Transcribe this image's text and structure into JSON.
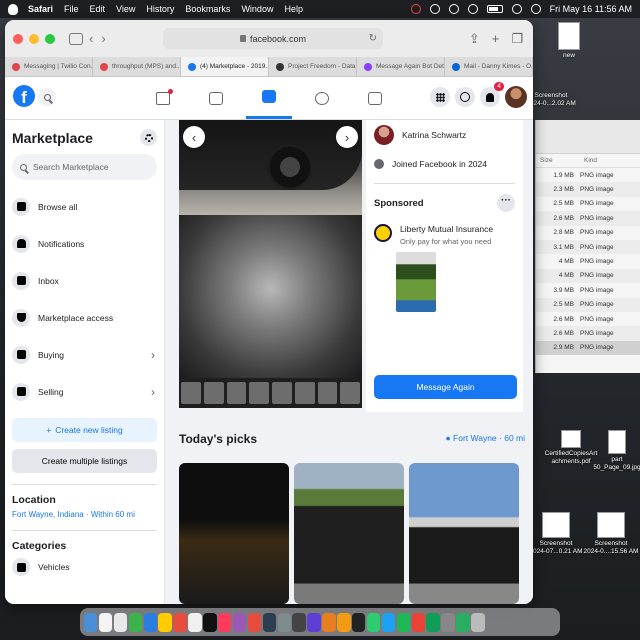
{
  "menubar": {
    "app": "Safari",
    "items": [
      "File",
      "Edit",
      "View",
      "History",
      "Bookmarks",
      "Window",
      "Help"
    ],
    "clock": "Fri May 16  11:56 AM"
  },
  "browser": {
    "url": "facebook.com",
    "tabs": [
      {
        "label": "Messaging | Twilio Con...",
        "color": "#e2434b"
      },
      {
        "label": "throughput (MPS) and...",
        "color": "#e2434b"
      },
      {
        "label": "(4) Marketplace - 2019...",
        "color": "#1877f2"
      },
      {
        "label": "Project Freedom - Data...",
        "color": "#333333"
      },
      {
        "label": "Message Again Bot Det...",
        "color": "#8a3ffc"
      },
      {
        "label": "Mail - Danny Kimes - O...",
        "color": "#0a64d6"
      }
    ]
  },
  "header": {
    "logo": "f",
    "notifications_badge": "4"
  },
  "sidebar": {
    "title": "Marketplace",
    "search_placeholder": "Search Marketplace",
    "items": [
      {
        "label": "Browse all"
      },
      {
        "label": "Notifications"
      },
      {
        "label": "Inbox"
      },
      {
        "label": "Marketplace access"
      },
      {
        "label": "Buying"
      },
      {
        "label": "Selling"
      }
    ],
    "create_listing": "Create new listing",
    "create_multiple": "Create multiple listings",
    "location_heading": "Location",
    "location_value": "Fort Wayne, Indiana · Within 60 mi",
    "categories_heading": "Categories",
    "first_category": "Vehicles"
  },
  "listing": {
    "seller_name": "Katrina Schwartz",
    "joined": "Joined Facebook in 2024",
    "sponsored_heading": "Sponsored",
    "ad_name": "Liberty Mutual Insurance",
    "ad_text": "Only pay for what you need",
    "message_button": "Message Again"
  },
  "picks": {
    "heading": "Today's picks",
    "location": "Fort Wayne · 60 mi"
  },
  "finder": {
    "columns": [
      "Size",
      "Kind"
    ],
    "rows": [
      {
        "size": "1.9 MB",
        "kind": "PNG image"
      },
      {
        "size": "2.3 MB",
        "kind": "PNG image"
      },
      {
        "size": "2.5 MB",
        "kind": "PNG image"
      },
      {
        "size": "2.6 MB",
        "kind": "PNG image"
      },
      {
        "size": "2.8 MB",
        "kind": "PNG image"
      },
      {
        "size": "3.1 MB",
        "kind": "PNG image"
      },
      {
        "size": "4 MB",
        "kind": "PNG image"
      },
      {
        "size": "4 MB",
        "kind": "PNG image"
      },
      {
        "size": "3.9 MB",
        "kind": "PNG image"
      },
      {
        "size": "2.5 MB",
        "kind": "PNG image"
      },
      {
        "size": "2.6 MB",
        "kind": "PNG image"
      },
      {
        "size": "2.6 MB",
        "kind": "PNG image"
      },
      {
        "size": "2.9 MB",
        "kind": "PNG image"
      }
    ]
  },
  "desktop": {
    "icon_new": "new",
    "icon_screenshot_top": "Screenshot\n2024-0...2.02 AM",
    "icon_certified": "CertifiedCopiesArt\nachments.pdf",
    "icon_part": "part\n50_Page_09.jpg",
    "icon_ss1": "Screenshot\n2024-07...0.21 AM",
    "icon_ss2": "Screenshot\n2024-0....15.56 AM"
  }
}
